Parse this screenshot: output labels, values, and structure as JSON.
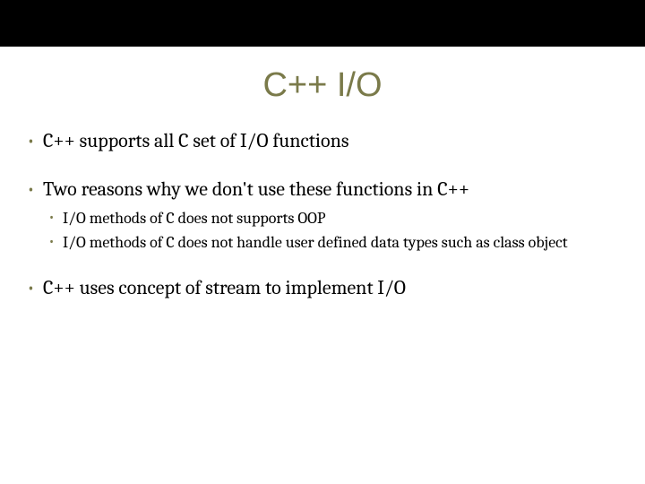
{
  "title": "C++ I/O",
  "bullets": {
    "item1": "C++ supports all C set of I/O functions",
    "item2": "Two reasons why we don't use these functions in C++",
    "item2_sub1": "I/O methods of C does not supports OOP",
    "item2_sub2": "I/O methods of C does not handle user defined data types such as class object",
    "item3": "C++ uses concept of stream to implement I/O"
  }
}
